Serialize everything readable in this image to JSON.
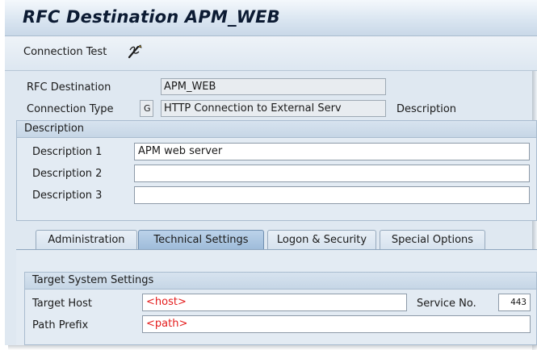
{
  "header": {
    "title": "RFC Destination APM_WEB"
  },
  "toolbar": {
    "connection_test": "Connection Test",
    "icon": "pen-wand-icon"
  },
  "details": {
    "rfc_destination_label": "RFC Destination",
    "rfc_destination_value": "APM_WEB",
    "connection_type_label": "Connection Type",
    "connection_type_code": "G",
    "connection_type_value": "HTTP Connection to External Serv",
    "description_link": "Description"
  },
  "description_group": {
    "title": "Description",
    "rows": [
      {
        "label": "Description 1",
        "value": "APM web server"
      },
      {
        "label": "Description 2",
        "value": ""
      },
      {
        "label": "Description 3",
        "value": ""
      }
    ]
  },
  "tabs": [
    {
      "label": "Administration",
      "active": false
    },
    {
      "label": "Technical Settings",
      "active": true
    },
    {
      "label": "Logon & Security",
      "active": false
    },
    {
      "label": "Special Options",
      "active": false
    }
  ],
  "target_system": {
    "title": "Target System Settings",
    "target_host_label": "Target Host",
    "target_host_value": "<host>",
    "service_no_label": "Service No.",
    "service_no_value": "443",
    "path_prefix_label": "Path Prefix",
    "path_prefix_value": "<path>"
  },
  "colors": {
    "annotation_red": "#e41b1b",
    "active_tab": "#9dbbd9"
  }
}
